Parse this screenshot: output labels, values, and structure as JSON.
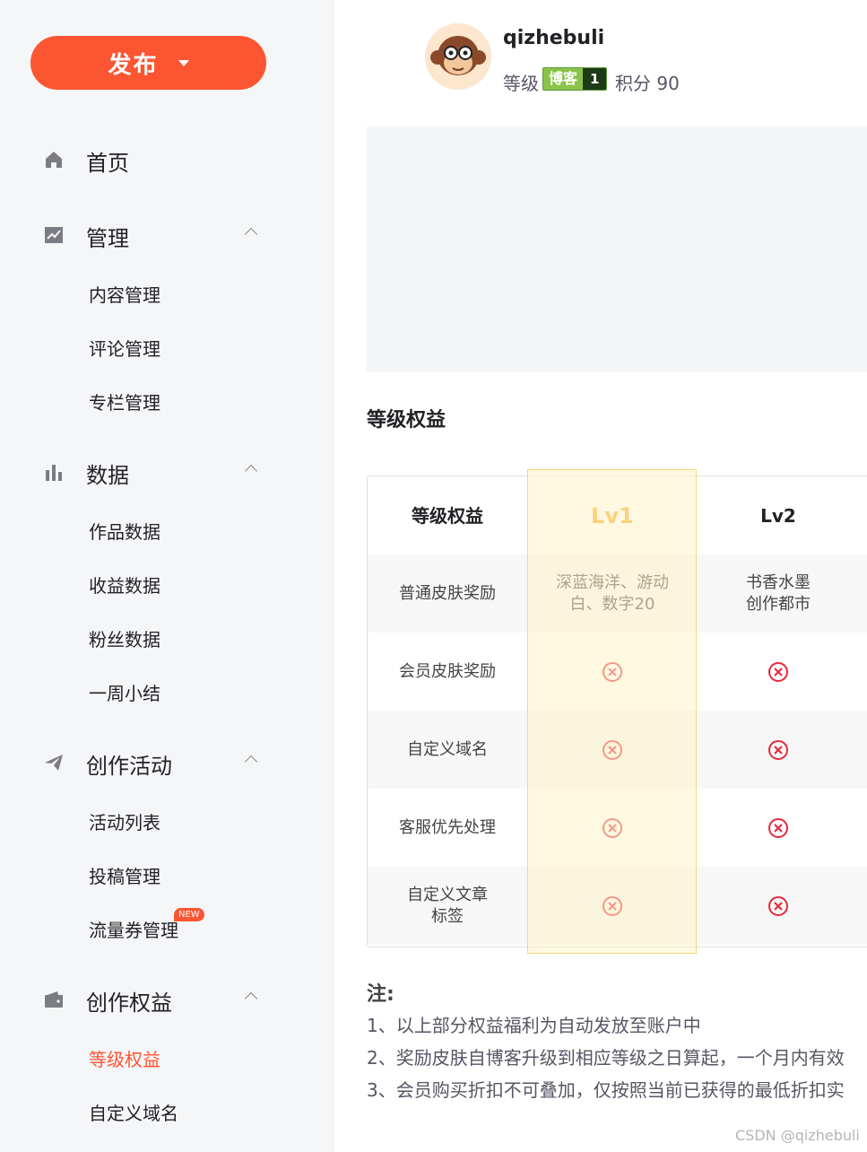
{
  "sidebar": {
    "publish_label": "发布",
    "home": "首页",
    "groups": [
      {
        "label": "管理",
        "items": [
          "内容管理",
          "评论管理",
          "专栏管理"
        ]
      },
      {
        "label": "数据",
        "items": [
          "作品数据",
          "收益数据",
          "粉丝数据",
          "一周小结"
        ]
      },
      {
        "label": "创作活动",
        "items": [
          "活动列表",
          "投稿管理",
          "流量券管理"
        ],
        "badge": "NEW"
      },
      {
        "label": "创作权益",
        "items": [
          "等级权益",
          "自定义域名"
        ],
        "active": "等级权益"
      }
    ]
  },
  "profile": {
    "username": "qizhebuli",
    "level_label": "等级",
    "badge_name": "博客",
    "badge_level": "1",
    "points": "积分 90"
  },
  "benefits": {
    "title": "等级权益",
    "header": [
      "等级权益",
      "Lv1",
      "Lv2"
    ],
    "rows": [
      {
        "name": "普通皮肤奖励",
        "lv1": "深蓝海洋、游动\n白、数字20",
        "lv2": "书香水墨\n创作都市"
      },
      {
        "name": "会员皮肤奖励",
        "lv1": "x",
        "lv2": "x"
      },
      {
        "name": "自定义域名",
        "lv1": "x",
        "lv2": "x"
      },
      {
        "name": "客服优先处理",
        "lv1": "x",
        "lv2": "x"
      },
      {
        "name": "自定义文章\n标签",
        "lv1": "x",
        "lv2": "x"
      }
    ]
  },
  "notes": {
    "title": "注:",
    "items": [
      "1、以上部分权益福利为自动发放至账户中",
      "2、奖励皮肤自博客升级到相应等级之日算起，一个月内有效",
      "3、会员购买折扣不可叠加，仅按照当前已获得的最低折扣实"
    ]
  },
  "watermark": "CSDN @qizhebuli",
  "colors": {
    "brand": "#fc5531",
    "lv1": "#f5a623",
    "x_icon": "#e8273c"
  }
}
